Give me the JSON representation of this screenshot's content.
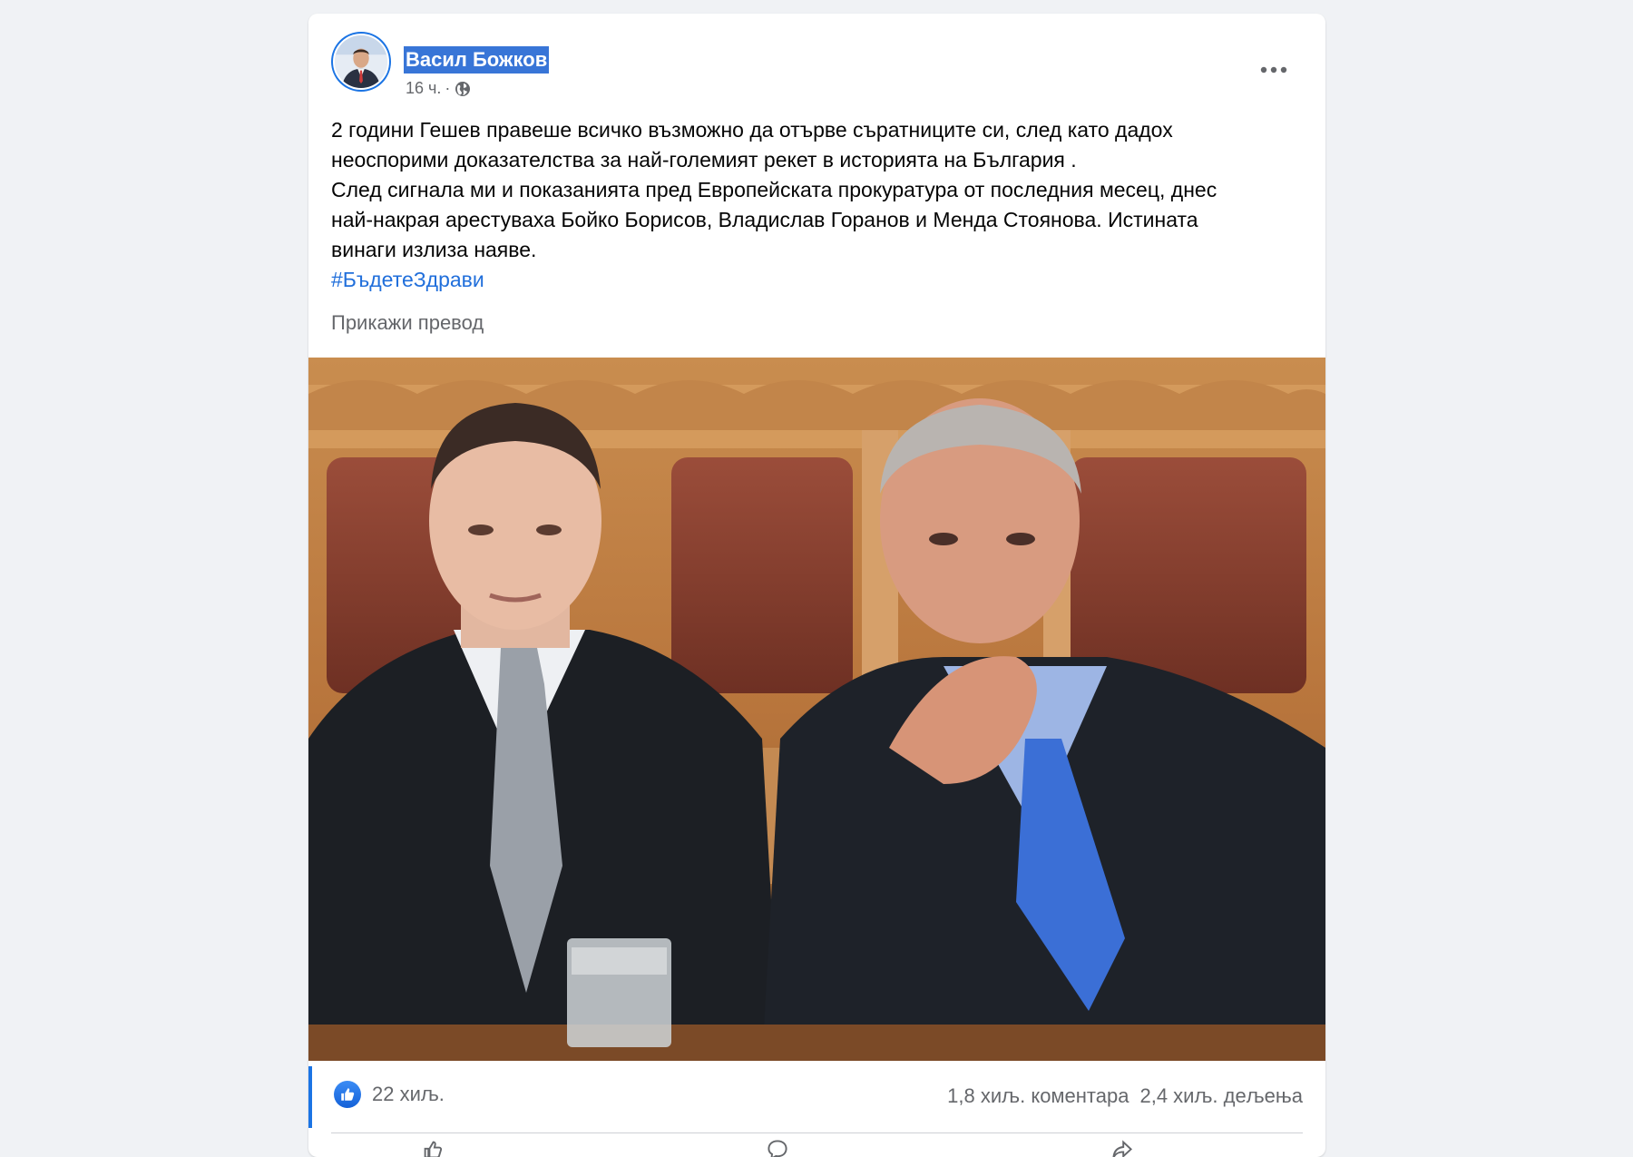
{
  "post": {
    "author": "Васил Божков",
    "time": "16 ч.",
    "separator": "·",
    "privacy_icon": "globe-icon",
    "more_icon": "more-options-icon",
    "text_lines": [
      "2 години Гешев правеше всичко възможно да отърве съратниците си, след като дадох",
      "неоспорими доказателства за най-големият рекет в историята на България .",
      "След сигнала ми и показанията пред Европейската прокуратура от последния месец, днес",
      "най-накрая арестуваха Бойко Борисов, Владислав Горанов и Менда Стоянова. Истината",
      "винаги излиза наяве."
    ],
    "hashtag": "#БъдетеЗдрави",
    "see_translation": "Прикажи превод"
  },
  "engagement": {
    "like_icon": "like-icon",
    "likes": "22 хиљ.",
    "comments": "1,8 хиљ. коментара",
    "shares": "2,4 хиљ. дељења"
  },
  "colors": {
    "accent": "#1b74e4",
    "hashtag": "#216fdb",
    "secondary_text": "#65676b",
    "selection": "#3875d7"
  }
}
